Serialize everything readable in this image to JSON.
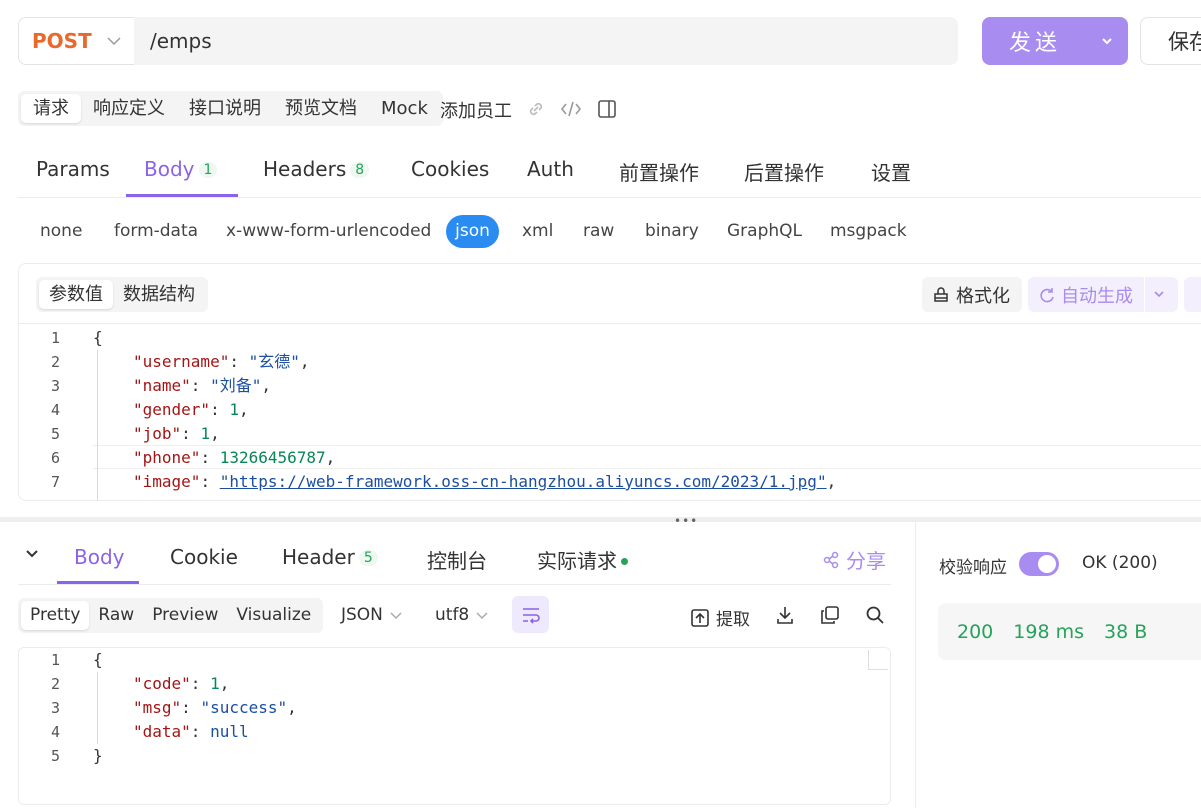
{
  "request": {
    "method": "POST",
    "url": "/emps",
    "send_label": "发送",
    "save_label": "保存"
  },
  "subtabs": [
    "请求",
    "响应定义",
    "接口说明",
    "预览文档",
    "Mock"
  ],
  "api_name": "添加员工",
  "main_tabs": {
    "params": "Params",
    "body": "Body",
    "body_count": "1",
    "headers": "Headers",
    "headers_count": "8",
    "cookies": "Cookies",
    "auth": "Auth",
    "pre": "前置操作",
    "post": "后置操作",
    "settings": "设置"
  },
  "body_types": [
    "none",
    "form-data",
    "x-www-form-urlencoded",
    "json",
    "xml",
    "raw",
    "binary",
    "GraphQL",
    "msgpack"
  ],
  "body_type_selected": "json",
  "editor": {
    "modes": [
      "参数值",
      "数据结构"
    ],
    "format_label": "格式化",
    "auto_label": "自动生成"
  },
  "request_body_lines": [
    {
      "no": "1",
      "key": "",
      "val": "",
      "raw": "{"
    },
    {
      "no": "2",
      "key": "\"username\"",
      "val": "\"玄德\"",
      "type": "s",
      "comma": ","
    },
    {
      "no": "3",
      "key": "\"name\"",
      "val": "\"刘备\"",
      "type": "s",
      "comma": ","
    },
    {
      "no": "4",
      "key": "\"gender\"",
      "val": "1",
      "type": "n",
      "comma": ","
    },
    {
      "no": "5",
      "key": "\"job\"",
      "val": "1",
      "type": "n",
      "comma": ","
    },
    {
      "no": "6",
      "key": "\"phone\"",
      "val": "13266456787",
      "type": "n",
      "comma": ","
    },
    {
      "no": "7",
      "key": "\"image\"",
      "val": "\"https://web-framework.oss-cn-hangzhou.aliyuncs.com/2023/1.jpg\"",
      "type": "s",
      "comma": ","
    }
  ],
  "response": {
    "tabs": {
      "body": "Body",
      "cookie": "Cookie",
      "header": "Header",
      "header_count": "5",
      "console": "控制台",
      "actual": "实际请求"
    },
    "share_label": "分享",
    "view_modes": [
      "Pretty",
      "Raw",
      "Preview",
      "Visualize"
    ],
    "format": "JSON",
    "encoding": "utf8",
    "extract_label": "提取",
    "validate_label": "校验响应",
    "ok_label": "OK (200)",
    "status_code": "200",
    "time": "198 ms",
    "size": "38 B"
  },
  "response_body_lines": [
    {
      "no": "1",
      "raw": "{"
    },
    {
      "no": "2",
      "key": "\"code\"",
      "val": "1",
      "type": "n",
      "comma": ","
    },
    {
      "no": "3",
      "key": "\"msg\"",
      "val": "\"success\"",
      "type": "s",
      "comma": ","
    },
    {
      "no": "4",
      "key": "\"data\"",
      "val": "null",
      "type": "s",
      "comma": ""
    },
    {
      "no": "5",
      "raw": "}"
    }
  ],
  "colors": {
    "accent": "#a98cf0",
    "tab_active": "#8a63e8",
    "method": "#e8692b",
    "json_pill": "#2a8cf0",
    "success": "#25a35a"
  }
}
